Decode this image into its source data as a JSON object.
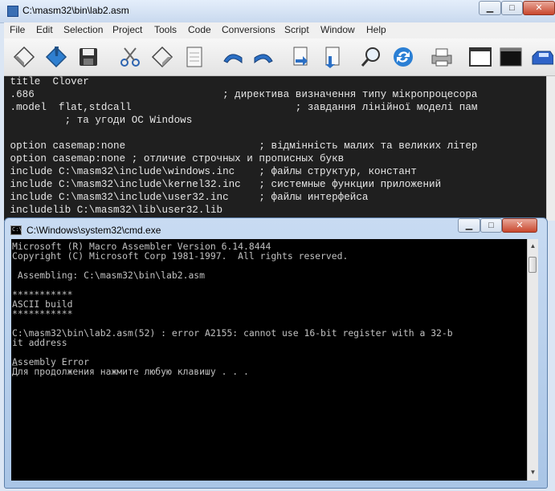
{
  "editor_window": {
    "title": "C:\\masm32\\bin\\lab2.asm",
    "menu": [
      "File",
      "Edit",
      "Selection",
      "Project",
      "Tools",
      "Code",
      "Conversions",
      "Script",
      "Window",
      "Help"
    ],
    "toolbar_icons": [
      "new-file-icon",
      "open-file-icon",
      "save-icon",
      "cut-icon",
      "copy-icon",
      "paste-icon",
      "undo-icon",
      "redo-icon",
      "paste-file-icon",
      "insert-file-icon",
      "find-icon",
      "replace-icon",
      "print-icon",
      "console-window-icon",
      "cmd-prompt-icon",
      "car-icon"
    ],
    "code_lines": [
      " title  Clover",
      " .686                               ; директива визначення типу мікропроцесора",
      " .model  flat,stdcall                           ; завдання лінійної моделі пам",
      "          ; та угоди ОС Windows",
      "",
      " option casemap:none                      ; відмінність малих та великих літер",
      " option casemap:none ; отличие строчных и прописных букв",
      " include C:\\masm32\\include\\windows.inc    ; файлы структур, констант",
      " include C:\\masm32\\include\\kernel32.inc   ; системные функции приложений",
      " include C:\\masm32\\include\\user32.inc     ; файлы интерфейса",
      " includelib C:\\masm32\\lib\\user32.lib"
    ],
    "colors": {
      "editor_bg": "#1f1f1f",
      "editor_text": "#e6e6e6"
    }
  },
  "cmd_window": {
    "title": "C:\\Windows\\system32\\cmd.exe",
    "console_lines": [
      "Microsoft (R) Macro Assembler Version 6.14.8444",
      "Copyright (C) Microsoft Corp 1981-1997.  All rights reserved.",
      "",
      " Assembling: C:\\masm32\\bin\\lab2.asm",
      "",
      "***********",
      "ASCII build",
      "***********",
      "",
      "C:\\masm32\\bin\\lab2.asm(52) : error A2155: cannot use 16-bit register with a 32-b",
      "it address",
      "",
      "_",
      "Assembly Error",
      "Для продолжения нажмите любую клавишу . . ."
    ],
    "colors": {
      "console_bg": "#000000",
      "console_text": "#c0c0c0"
    }
  }
}
